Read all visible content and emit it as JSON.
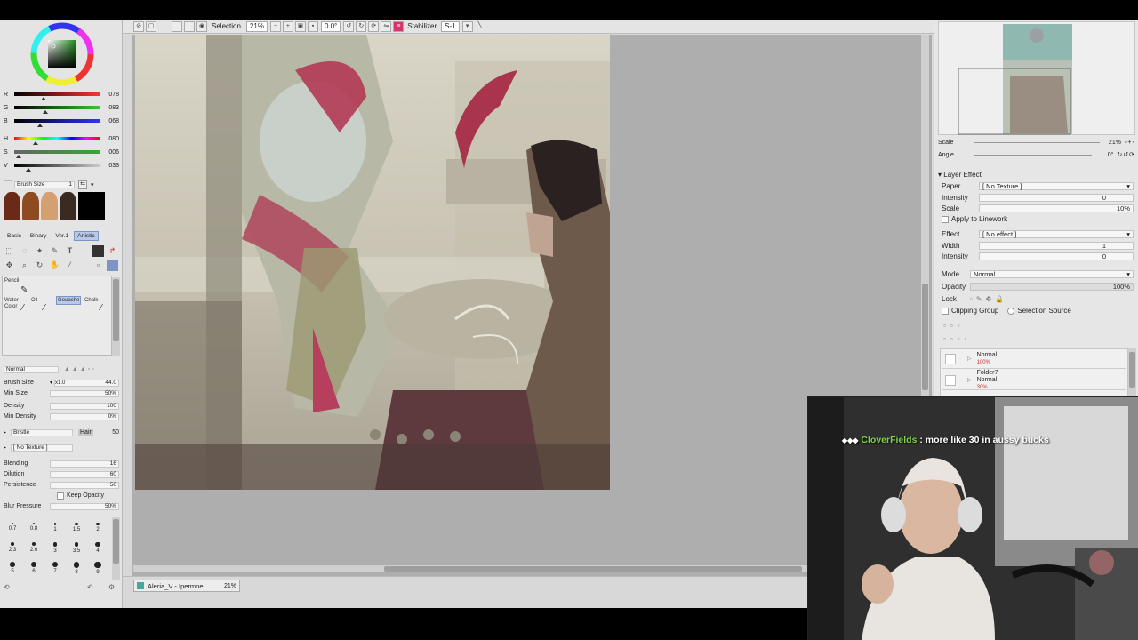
{
  "colors": {
    "accent": "#b8c8e8",
    "canvas_bg": "#aeaeae",
    "panel_bg": "#e4e4e4",
    "hue_marker": "#4aa64a"
  },
  "color_sliders": [
    {
      "label": "R",
      "value": "078",
      "gradient": "linear-gradient(90deg,#000,#f33)"
    },
    {
      "label": "G",
      "value": "083",
      "gradient": "linear-gradient(90deg,#000,#3c3)"
    },
    {
      "label": "B",
      "value": "068",
      "gradient": "linear-gradient(90deg,#000,#33f)"
    },
    {
      "label": "H",
      "value": "080",
      "gradient": "linear-gradient(90deg,#f00,#ff0,#0f0,#0ff,#00f,#f0f,#f00)"
    },
    {
      "label": "S",
      "value": "006",
      "gradient": "linear-gradient(90deg,#666,#3a3)"
    },
    {
      "label": "V",
      "value": "033",
      "gradient": "linear-gradient(90deg,#000,#ccc)"
    }
  ],
  "brush_size_mini": {
    "label": "Brush Size",
    "value": "1"
  },
  "tool_modes": [
    "Basic",
    "Binary",
    "Ver.1",
    "Artistic"
  ],
  "brush_tools": [
    {
      "label": "Pencil"
    },
    {
      "label": "Water Color"
    },
    {
      "label": "Oil"
    },
    {
      "label": "Gouache"
    },
    {
      "label": "Chalk"
    }
  ],
  "blend_mode": "Normal",
  "brush_props": {
    "brush_size": {
      "label": "Brush Size",
      "mult": "x1.0",
      "value": "44.0"
    },
    "min_size": {
      "label": "Min Size",
      "value": "50%"
    },
    "density": {
      "label": "Density",
      "value": "100"
    },
    "min_density": {
      "label": "Min Density",
      "value": "0%"
    },
    "bristle": {
      "label": "Bristle",
      "hair_label": "Hair",
      "hair_value": "50"
    },
    "texture": "[ No Texture ]",
    "blending": {
      "label": "Blending",
      "value": "16"
    },
    "dilution": {
      "label": "Dilution",
      "value": "60"
    },
    "persistence": {
      "label": "Persistence",
      "value": "50"
    },
    "keep_opacity": "Keep Opacity",
    "blur_pressure": {
      "label": "Blur Pressure",
      "value": "50%"
    }
  },
  "dot_sizes": [
    "0.7",
    "0.8",
    "1",
    "1.5",
    "2",
    "2.3",
    "2.6",
    "3",
    "3.5",
    "4",
    "5",
    "6",
    "7",
    "8",
    "9"
  ],
  "toolbar": {
    "selection_label": "Selection",
    "zoom": "21%",
    "rotation": "0.0°",
    "stabilizer_label": "Stabilizer",
    "stabilizer_value": "S-1"
  },
  "document_tab": {
    "name": "Aleria_V - Ipermne...",
    "zoom": "21%"
  },
  "navigator": {
    "scale_label": "Scale",
    "scale_value": "21%",
    "angle_label": "Angle",
    "angle_value": "0°"
  },
  "layer_effect": {
    "title": "Layer Effect",
    "paper_label": "Paper",
    "paper_value": "[ No Texture ]",
    "intensity_label": "Intensity",
    "intensity_value": "0",
    "scale_label": "Scale",
    "scale_value": "10%",
    "apply_linework": "Apply to Linework",
    "effect_label": "Effect",
    "effect_value": "[ No effect ]",
    "width_label": "Width",
    "width_value": "1",
    "intensity2_label": "Intensity",
    "intensity2_value": "0"
  },
  "layer_props": {
    "mode_label": "Mode",
    "mode_value": "Normal",
    "opacity_label": "Opacity",
    "opacity_value": "100%",
    "lock_label": "Lock",
    "clipping": "Clipping Group",
    "selection_source": "Selection Source"
  },
  "layers": [
    {
      "name": "Normal",
      "sub": "100%"
    },
    {
      "name": "Folder7",
      "mode": "Normal",
      "sub": "30%"
    }
  ],
  "stream_chat": {
    "user": "CloverFields",
    "message": ": more like 30 in aussy bucks"
  }
}
